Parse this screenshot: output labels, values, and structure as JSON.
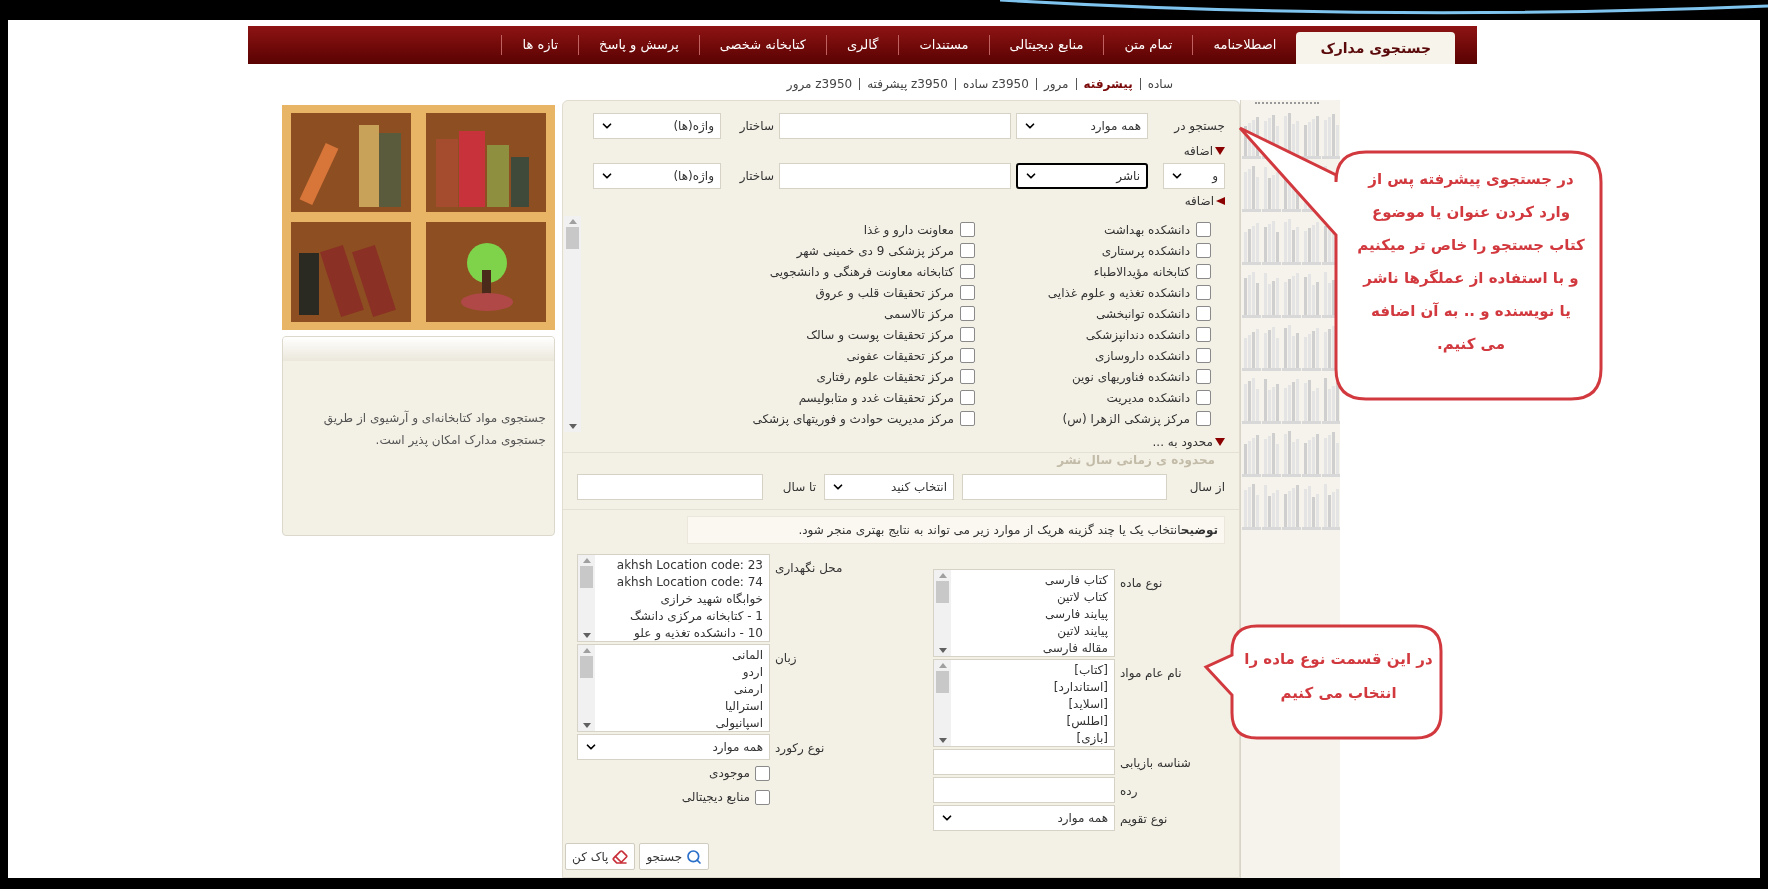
{
  "nav": {
    "tabs": [
      {
        "label": "جستجوی مدارک",
        "selected": true
      },
      {
        "label": "اصطلاحنامه",
        "selected": false
      },
      {
        "label": "تمام متن",
        "selected": false
      },
      {
        "label": "منابع دیجیتالی",
        "selected": false
      },
      {
        "label": "مستندات",
        "selected": false
      },
      {
        "label": "گالری",
        "selected": false
      },
      {
        "label": "کتابخانه شخصی",
        "selected": false
      },
      {
        "label": "پرسش و پاسخ",
        "selected": false
      },
      {
        "label": "تازه ها",
        "selected": false
      }
    ]
  },
  "sub_nav": [
    {
      "label": "ساده",
      "selected": false
    },
    {
      "label": "پیشرفته",
      "selected": true
    },
    {
      "label": "مرور",
      "selected": false
    },
    {
      "label": "ساده z3950",
      "selected": false
    },
    {
      "label": "پیشرفته z3950",
      "selected": false
    },
    {
      "label": "مرور z3950",
      "selected": false
    }
  ],
  "search_rows": [
    {
      "kind": "first",
      "label": "جستجو در",
      "field": "همه موارد",
      "focused": false,
      "structure_label": "ساختار",
      "match": "واژه(ها)",
      "add": "اضافه",
      "add_expanded": true
    },
    {
      "kind": "extra",
      "operator": "و",
      "field": "ناشر",
      "focused": true,
      "structure_label": "ساختار",
      "match": "واژه(ها)",
      "add": "اضافه",
      "add_expanded": false
    }
  ],
  "libraries": {
    "columns": [
      [
        {
          "label": "دانشکده بهداشت",
          "checked": false
        },
        {
          "label": "دانشکده پرستاری",
          "checked": false
        },
        {
          "label": "کتابخانه مؤیدالاطباء",
          "checked": false
        },
        {
          "label": "دانشکده تغذیه و علوم غذایی",
          "checked": false
        },
        {
          "label": "دانشکده توانبخشی",
          "checked": false
        },
        {
          "label": "دانشکده دندانپزشکی",
          "checked": false
        },
        {
          "label": "دانشکده داروسازی",
          "checked": false
        },
        {
          "label": "دانشکده فناوریهای نوین",
          "checked": false
        },
        {
          "label": "دانشکده مدیریت",
          "checked": false
        },
        {
          "label": "مرکز پزشکی الزهرا (س)",
          "checked": false
        }
      ],
      [
        {
          "label": "معاونت دارو و غذا",
          "checked": false
        },
        {
          "label": "مرکز پزشکی 9 دی خمینی شهر",
          "checked": false
        },
        {
          "label": "کتابخانه معاونت فرهنگی و دانشجویی",
          "checked": false
        },
        {
          "label": "مرکز تحقیقات قلب و عروق",
          "checked": false
        },
        {
          "label": "مرکز تالاسمی",
          "checked": false
        },
        {
          "label": "مرکز تحقیقات پوست و سالک",
          "checked": false
        },
        {
          "label": "مرکز تحقیقات عفونی",
          "checked": false
        },
        {
          "label": "مرکز تحقیقات علوم رفتاری",
          "checked": false
        },
        {
          "label": "مرکز تحقیقات غدد و متابولیسم",
          "checked": false
        },
        {
          "label": "مرکز مدیریت حوادث و فوریتهای پزشکی",
          "checked": false
        }
      ]
    ]
  },
  "limit": {
    "label": "محدود به ...",
    "expanded": true
  },
  "year_range": {
    "legend": "محدوده ی زمانی سال نشر",
    "from_label": "از سال",
    "calendar": "انتخاب کنید",
    "to_label": "تا سال"
  },
  "note": "**توضیح**انتخاب یک یا چند گزینه هریک از موارد زیر می تواند به نتایج بهتری منجر شود.",
  "filters_right": [
    {
      "kind": "list",
      "label": "نوع ماده",
      "options": [
        "کتاب فارسی",
        "کتاب لاتین",
        "پیایند فارسی",
        "پیایند لاتین",
        "مقاله فارسی"
      ]
    },
    {
      "kind": "list",
      "label": "نام عام مواد",
      "options": [
        "[کتاب]",
        "[استاندارد]",
        "[اسلاید]",
        "[اطلس]",
        "[بازی]"
      ]
    },
    {
      "kind": "input",
      "label": "شناسه بازیابی"
    },
    {
      "kind": "input",
      "label": "رده"
    },
    {
      "kind": "select",
      "label": "نوع تقویم",
      "value": "همه موارد"
    }
  ],
  "filters_left": [
    {
      "kind": "list",
      "label": "محل نگهداری",
      "options": [
        "akhsh Location code: 23",
        "akhsh Location code: 74",
        "خوابگاه شهید خرازی",
        "1 - کتابخانه مرکزی دانشگ",
        "10 - دانشکده تغذیه و علو"
      ]
    },
    {
      "kind": "list",
      "label": "زبان",
      "options": [
        "المانی",
        "اردو",
        "ارمنی",
        "استرالیا",
        "اسپانیولی"
      ]
    },
    {
      "kind": "select",
      "label": "نوع رکورد",
      "value": "همه موارد"
    },
    {
      "kind": "checkbox",
      "label": "موجودی",
      "checked": false
    },
    {
      "kind": "checkbox",
      "label": "منابع دیجیتالی",
      "checked": false
    }
  ],
  "buttons": [
    {
      "kind": "search",
      "label": "جستجو"
    },
    {
      "kind": "clear",
      "label": "پاک کن"
    }
  ],
  "info_panel": {
    "text": "جستجوی مواد کتابخانه‌ای و آرشیوی از طریق جستجوی مدارک امکان پذیر است."
  },
  "callouts": [
    {
      "text": "در جستجوی پیشرفته پس از وارد کردن عنوان یا موضوع کتاب جستجو را خاص تر میکنیم و با استفاده از عملگرها ناشر یا نویسنده و .. به آن اضافه می کنیم."
    },
    {
      "text": "در این قسمت نوع ماده را انتخاب می کنیم"
    }
  ]
}
